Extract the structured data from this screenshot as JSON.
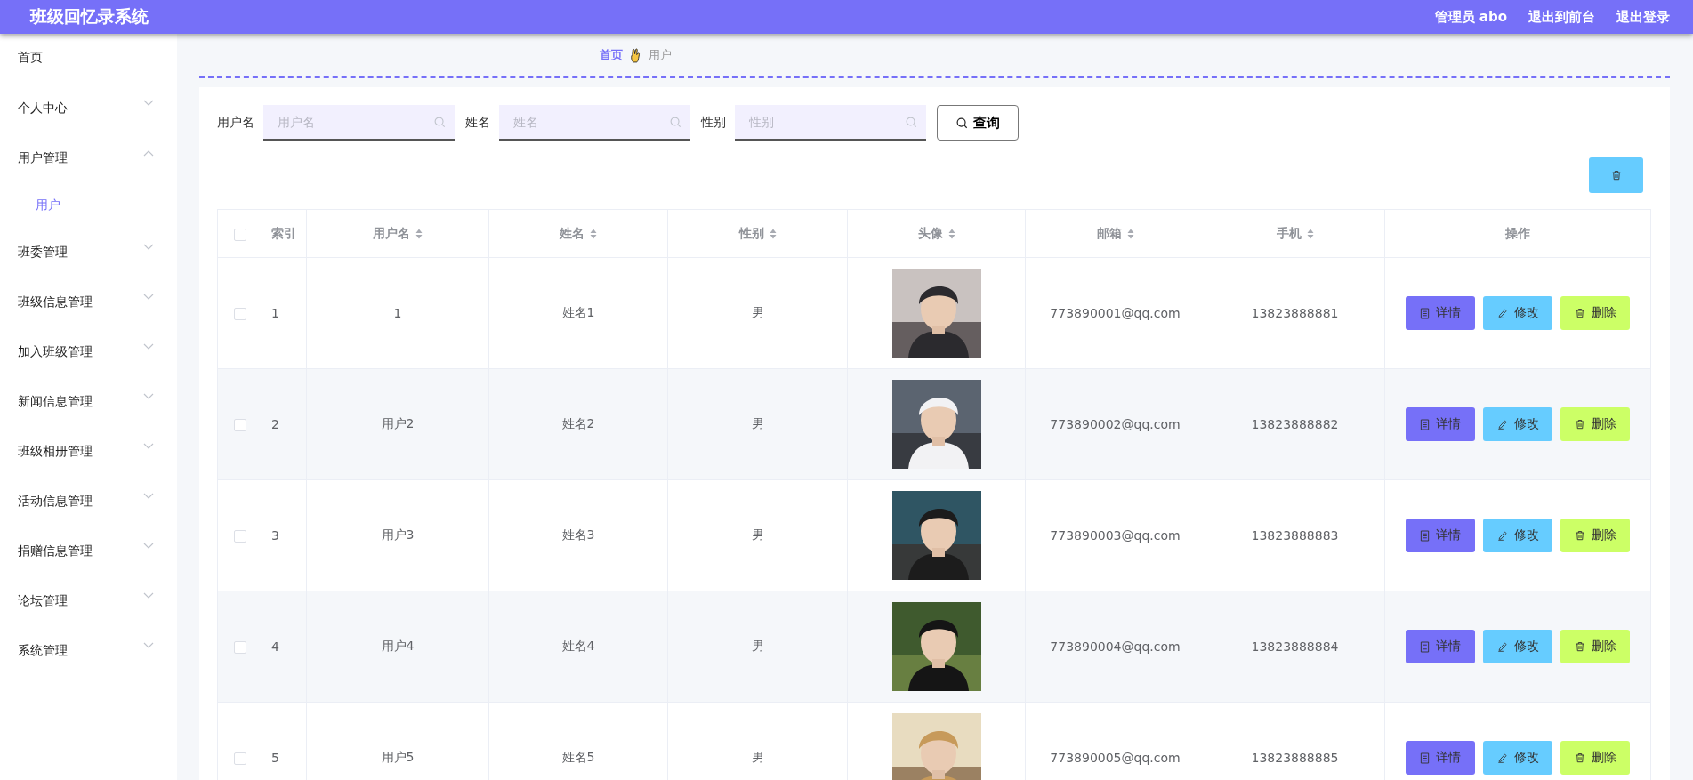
{
  "header": {
    "title": "班级回忆录系统",
    "links": [
      "管理员 abo",
      "退出到前台",
      "退出登录"
    ]
  },
  "sidebar": {
    "items": [
      {
        "label": "首页",
        "kind": "link"
      },
      {
        "label": "个人中心",
        "kind": "group",
        "expanded": false
      },
      {
        "label": "用户管理",
        "kind": "group",
        "expanded": true,
        "children": [
          {
            "label": "用户",
            "selected": true
          }
        ]
      },
      {
        "label": "班委管理",
        "kind": "group",
        "expanded": false
      },
      {
        "label": "班级信息管理",
        "kind": "group",
        "expanded": false
      },
      {
        "label": "加入班级管理",
        "kind": "group",
        "expanded": false
      },
      {
        "label": "新闻信息管理",
        "kind": "group",
        "expanded": false
      },
      {
        "label": "班级相册管理",
        "kind": "group",
        "expanded": false
      },
      {
        "label": "活动信息管理",
        "kind": "group",
        "expanded": false
      },
      {
        "label": "捐赠信息管理",
        "kind": "group",
        "expanded": false
      },
      {
        "label": "论坛管理",
        "kind": "group",
        "expanded": false
      },
      {
        "label": "系统管理",
        "kind": "group",
        "expanded": false
      }
    ]
  },
  "breadcrumb": [
    "首页",
    "用户"
  ],
  "search": {
    "fields": [
      {
        "label": "用户名",
        "placeholder": "用户名"
      },
      {
        "label": "姓名",
        "placeholder": "姓名"
      },
      {
        "label": "性别",
        "placeholder": "性别"
      }
    ],
    "button": "查询"
  },
  "table": {
    "header_checked": false,
    "columns": [
      {
        "label": "索引",
        "sortable": false
      },
      {
        "label": "用户名",
        "sortable": true
      },
      {
        "label": "姓名",
        "sortable": true
      },
      {
        "label": "性别",
        "sortable": true
      },
      {
        "label": "头像",
        "sortable": true
      },
      {
        "label": "邮箱",
        "sortable": true
      },
      {
        "label": "手机",
        "sortable": true
      },
      {
        "label": "操作",
        "sortable": false
      }
    ],
    "rows": [
      {
        "checked": false,
        "index": "1",
        "username": "1",
        "name": "姓名1",
        "gender": "男",
        "email": "773890001@qq.com",
        "phone": "13823888881",
        "actions": [
          "详情",
          "修改",
          "删除"
        ]
      },
      {
        "checked": false,
        "index": "2",
        "username": "用户2",
        "name": "姓名2",
        "gender": "男",
        "email": "773890002@qq.com",
        "phone": "13823888882",
        "actions": [
          "详情",
          "修改",
          "删除"
        ]
      },
      {
        "checked": false,
        "index": "3",
        "username": "用户3",
        "name": "姓名3",
        "gender": "男",
        "email": "773890003@qq.com",
        "phone": "13823888883",
        "actions": [
          "详情",
          "修改",
          "删除"
        ]
      },
      {
        "checked": false,
        "index": "4",
        "username": "用户4",
        "name": "姓名4",
        "gender": "男",
        "email": "773890004@qq.com",
        "phone": "13823888884",
        "actions": [
          "详情",
          "修改",
          "删除"
        ]
      },
      {
        "checked": false,
        "index": "5",
        "username": "用户5",
        "name": "姓名5",
        "gender": "男",
        "email": "773890005@qq.com",
        "phone": "13823888885",
        "actions": [
          "详情",
          "修改",
          "删除"
        ]
      }
    ]
  }
}
